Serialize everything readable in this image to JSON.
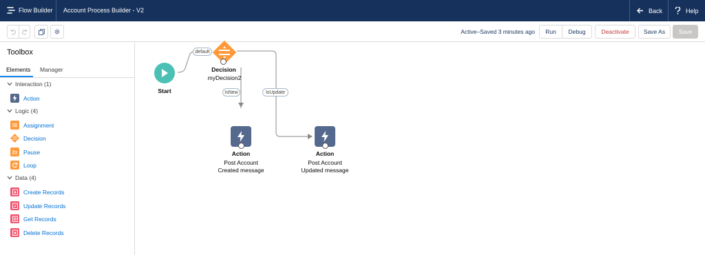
{
  "header": {
    "app_title": "Flow Builder",
    "flow_title": "Account Process Builder - V2",
    "back_label": "Back",
    "help_label": "Help"
  },
  "toolbar": {
    "status": "Active–Saved 3 minutes ago",
    "run_label": "Run",
    "debug_label": "Debug",
    "deactivate_label": "Deactivate",
    "save_as_label": "Save As",
    "save_label": "Save"
  },
  "toolbox": {
    "title": "Toolbox",
    "tabs": [
      {
        "label": "Elements",
        "active": true
      },
      {
        "label": "Manager",
        "active": false
      }
    ],
    "sections": [
      {
        "label": "Interaction (1)",
        "items": [
          {
            "label": "Action",
            "icon": "lightning-icon",
            "color": "#54698d"
          }
        ]
      },
      {
        "label": "Logic (4)",
        "items": [
          {
            "label": "Assignment",
            "icon": "assignment-icon",
            "color": "#ff9a3c"
          },
          {
            "label": "Decision",
            "icon": "decision-icon",
            "color": "#ff9a3c"
          },
          {
            "label": "Pause",
            "icon": "pause-icon",
            "color": "#ff9a3c"
          },
          {
            "label": "Loop",
            "icon": "loop-icon",
            "color": "#ff9a3c"
          }
        ]
      },
      {
        "label": "Data (4)",
        "items": [
          {
            "label": "Create Records",
            "icon": "create-records-icon",
            "color": "#f2536d"
          },
          {
            "label": "Update Records",
            "icon": "update-records-icon",
            "color": "#f2536d"
          },
          {
            "label": "Get Records",
            "icon": "get-records-icon",
            "color": "#f2536d"
          },
          {
            "label": "Delete Records",
            "icon": "delete-records-icon",
            "color": "#f2536d"
          }
        ]
      }
    ]
  },
  "canvas": {
    "start": {
      "label": "Start",
      "color": "#4bc1b5"
    },
    "decision": {
      "label": "Decision",
      "name": "myDecision2",
      "color": "#ff9a3c"
    },
    "connectors": {
      "default": "default",
      "is_new": "IsNew",
      "is_update": "IsUpdate"
    },
    "action1": {
      "label": "Action",
      "line1": "Post Account",
      "line2": "Created message",
      "color": "#54698d"
    },
    "action2": {
      "label": "Action",
      "line1": "Post Account",
      "line2": "Updated message",
      "color": "#54698d"
    }
  }
}
